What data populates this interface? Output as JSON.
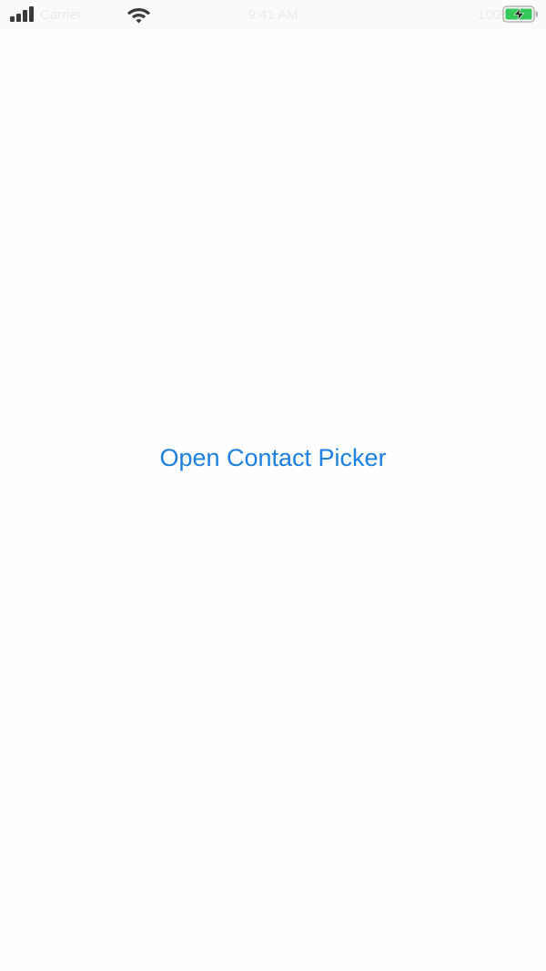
{
  "status_bar": {
    "carrier": "Carrier",
    "time": "9:41 AM",
    "battery_percent": "100%",
    "icons": [
      "signal-icon",
      "wifi-icon",
      "battery-charging-icon"
    ],
    "battery_color": "#34c759"
  },
  "main": {
    "open_contact_picker_label": "Open Contact Picker",
    "accent_color": "#1a7fe0"
  }
}
